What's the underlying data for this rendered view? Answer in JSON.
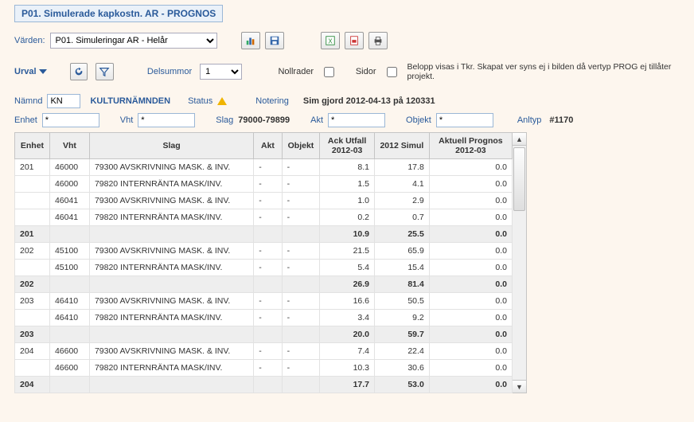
{
  "title": "P01. Simulerade kapkostn. AR - PROGNOS",
  "toolbar": {
    "varden_label": "Värden:",
    "varden_select": "P01. Simuleringar AR - Helår"
  },
  "filterbar": {
    "urval_label": "Urval",
    "delsummor_label": "Delsummor",
    "delsummor_value": "1",
    "nollrader_label": "Nollrader",
    "sidor_label": "Sidor",
    "right_note": "Belopp visas i Tkr. Skapat ver syns ej i bilden då vertyp PROG ej tillåter projekt."
  },
  "filters": {
    "namnd_label": "Nämnd",
    "namnd_value": "KN",
    "namnd_name": "KULTURNÄMNDEN",
    "status_label": "Status",
    "notering_label": "Notering",
    "notering_value": "Sim gjord 2012-04-13 på 120331",
    "enhet_label": "Enhet",
    "enhet_value": "*",
    "vht_label": "Vht",
    "vht_value": "*",
    "slag_label": "Slag",
    "slag_value": "79000-79899",
    "akt_label": "Akt",
    "akt_value": "*",
    "objekt_label": "Objekt",
    "objekt_value": "*",
    "anltyp_label": "Anltyp",
    "anltyp_value": "#1170"
  },
  "headers": {
    "enhet": "Enhet",
    "vht": "Vht",
    "slag": "Slag",
    "akt": "Akt",
    "objekt": "Objekt",
    "ack": "Ack Utfall 2012-03",
    "simul": "2012 Simul",
    "prognos": "Aktuell Prognos 2012-03"
  },
  "rows": [
    {
      "type": "data",
      "enhet": "201",
      "vht": "46000",
      "slag": "79300 AVSKRIVNING MASK. & INV.",
      "akt": "-",
      "obj": "-",
      "ack": "8.1",
      "sim": "17.8",
      "prog": "0.0"
    },
    {
      "type": "data",
      "enhet": "",
      "vht": "46000",
      "slag": "79820 INTERNRÄNTA MASK/INV.",
      "akt": "-",
      "obj": "-",
      "ack": "1.5",
      "sim": "4.1",
      "prog": "0.0"
    },
    {
      "type": "data",
      "enhet": "",
      "vht": "46041",
      "slag": "79300 AVSKRIVNING MASK. & INV.",
      "akt": "-",
      "obj": "-",
      "ack": "1.0",
      "sim": "2.9",
      "prog": "0.0"
    },
    {
      "type": "data",
      "enhet": "",
      "vht": "46041",
      "slag": "79820 INTERNRÄNTA MASK/INV.",
      "akt": "-",
      "obj": "-",
      "ack": "0.2",
      "sim": "0.7",
      "prog": "0.0"
    },
    {
      "type": "sub",
      "enhet": "201",
      "ack": "10.9",
      "sim": "25.5",
      "prog": "0.0"
    },
    {
      "type": "data",
      "enhet": "202",
      "vht": "45100",
      "slag": "79300 AVSKRIVNING MASK. & INV.",
      "akt": "-",
      "obj": "-",
      "ack": "21.5",
      "sim": "65.9",
      "prog": "0.0"
    },
    {
      "type": "data",
      "enhet": "",
      "vht": "45100",
      "slag": "79820 INTERNRÄNTA MASK/INV.",
      "akt": "-",
      "obj": "-",
      "ack": "5.4",
      "sim": "15.4",
      "prog": "0.0"
    },
    {
      "type": "sub",
      "enhet": "202",
      "ack": "26.9",
      "sim": "81.4",
      "prog": "0.0"
    },
    {
      "type": "data",
      "enhet": "203",
      "vht": "46410",
      "slag": "79300 AVSKRIVNING MASK. & INV.",
      "akt": "-",
      "obj": "-",
      "ack": "16.6",
      "sim": "50.5",
      "prog": "0.0"
    },
    {
      "type": "data",
      "enhet": "",
      "vht": "46410",
      "slag": "79820 INTERNRÄNTA MASK/INV.",
      "akt": "-",
      "obj": "-",
      "ack": "3.4",
      "sim": "9.2",
      "prog": "0.0"
    },
    {
      "type": "sub",
      "enhet": "203",
      "ack": "20.0",
      "sim": "59.7",
      "prog": "0.0"
    },
    {
      "type": "data",
      "enhet": "204",
      "vht": "46600",
      "slag": "79300 AVSKRIVNING MASK. & INV.",
      "akt": "-",
      "obj": "-",
      "ack": "7.4",
      "sim": "22.4",
      "prog": "0.0"
    },
    {
      "type": "data",
      "enhet": "",
      "vht": "46600",
      "slag": "79820 INTERNRÄNTA MASK/INV.",
      "akt": "-",
      "obj": "-",
      "ack": "10.3",
      "sim": "30.6",
      "prog": "0.0"
    },
    {
      "type": "sub",
      "enhet": "204",
      "ack": "17.7",
      "sim": "53.0",
      "prog": "0.0"
    }
  ]
}
